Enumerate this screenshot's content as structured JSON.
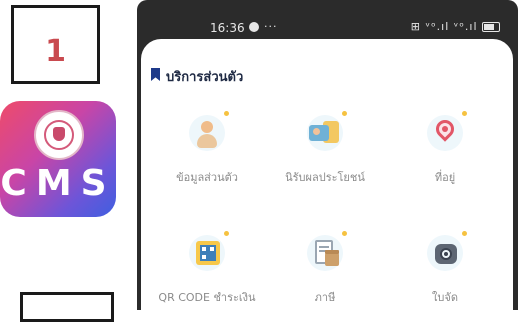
{
  "annotation": {
    "step_number": "1"
  },
  "app_icon": {
    "label": "CMS"
  },
  "status_bar": {
    "time": "16:36",
    "extra": "···",
    "icons": "⊞ ᵛᵒ.ıl ᵛᵒ.ıl"
  },
  "section": {
    "title": "บริการส่วนตัว"
  },
  "services": [
    {
      "label": "ข้อมูลส่วนตัว",
      "icon": "person-icon"
    },
    {
      "label": "นิรับผลประโยชน์",
      "icon": "id-card-icon"
    },
    {
      "label": "ที่อยู่",
      "icon": "location-pin-icon"
    },
    {
      "label": "QR CODE ชำระเงิน",
      "icon": "qr-code-icon"
    },
    {
      "label": "ภาษี",
      "icon": "document-box-icon"
    },
    {
      "label": "ใบจัด",
      "icon": "camera-icon"
    }
  ],
  "colors": {
    "annotation_number": "#c94a4f",
    "app_gradient_start": "#ee4b6a",
    "app_gradient_end": "#3f5fe0",
    "phone_frame": "#2b2b2b",
    "section_title": "#1f2a44",
    "tile_label": "#8b8b8b"
  }
}
